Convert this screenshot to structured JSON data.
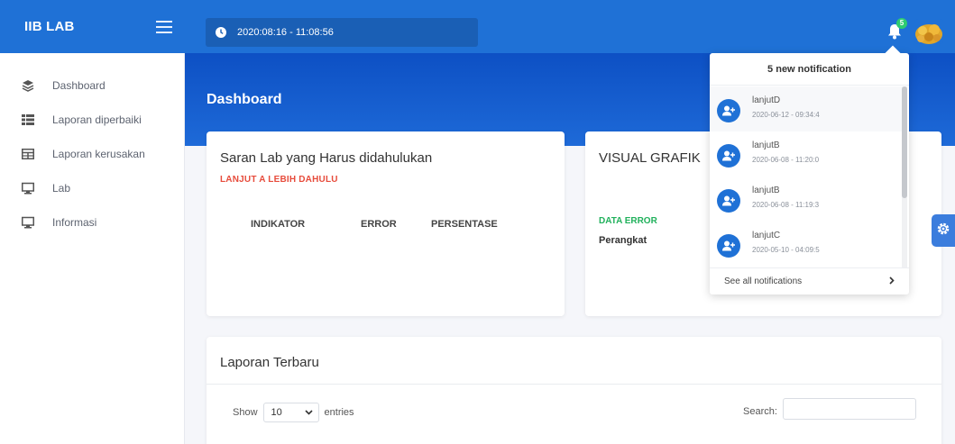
{
  "app": {
    "brand": "IIB LAB"
  },
  "sidebar": {
    "items": [
      {
        "label": "Dashboard",
        "icon": "layers-icon"
      },
      {
        "label": "Laporan diperbaiki",
        "icon": "list-icon"
      },
      {
        "label": "Laporan kerusakan",
        "icon": "table-icon"
      },
      {
        "label": "Lab",
        "icon": "monitor-icon"
      },
      {
        "label": "Informasi",
        "icon": "monitor-icon"
      }
    ]
  },
  "topbar": {
    "datetime": "2020:08:16 - 11:08:56",
    "notification_count": "5"
  },
  "page": {
    "title": "Dashboard"
  },
  "saran": {
    "title": "Saran Lab yang Harus didahulukan",
    "subtitle": "LANJUT A LEBIH DAHULU",
    "columns": [
      "INDIKATOR",
      "ERROR",
      "PERSENTASE"
    ]
  },
  "visual": {
    "title": "VISUAL GRAFIK",
    "subtitle": "DATA ERROR",
    "label": "Perangkat"
  },
  "laporan": {
    "title": "Laporan Terbaru",
    "show_label": "Show",
    "entries_value": "10",
    "entries_label": "entries",
    "search_label": "Search:"
  },
  "notifications": {
    "header": "5 new notification",
    "items": [
      {
        "name": "lanjutD",
        "time": "2020-06-12 - 09:34:4"
      },
      {
        "name": "lanjutB",
        "time": "2020-06-08 - 11:20:0"
      },
      {
        "name": "lanjutB",
        "time": "2020-06-08 - 11:19:3"
      },
      {
        "name": "lanjutC",
        "time": "2020-05-10 - 04:09:5"
      }
    ],
    "footer": "See all notifications"
  },
  "colors": {
    "primary": "#1f71d6",
    "banner": "#0d50c4",
    "danger": "#e74c3c",
    "success": "#21b15c"
  }
}
